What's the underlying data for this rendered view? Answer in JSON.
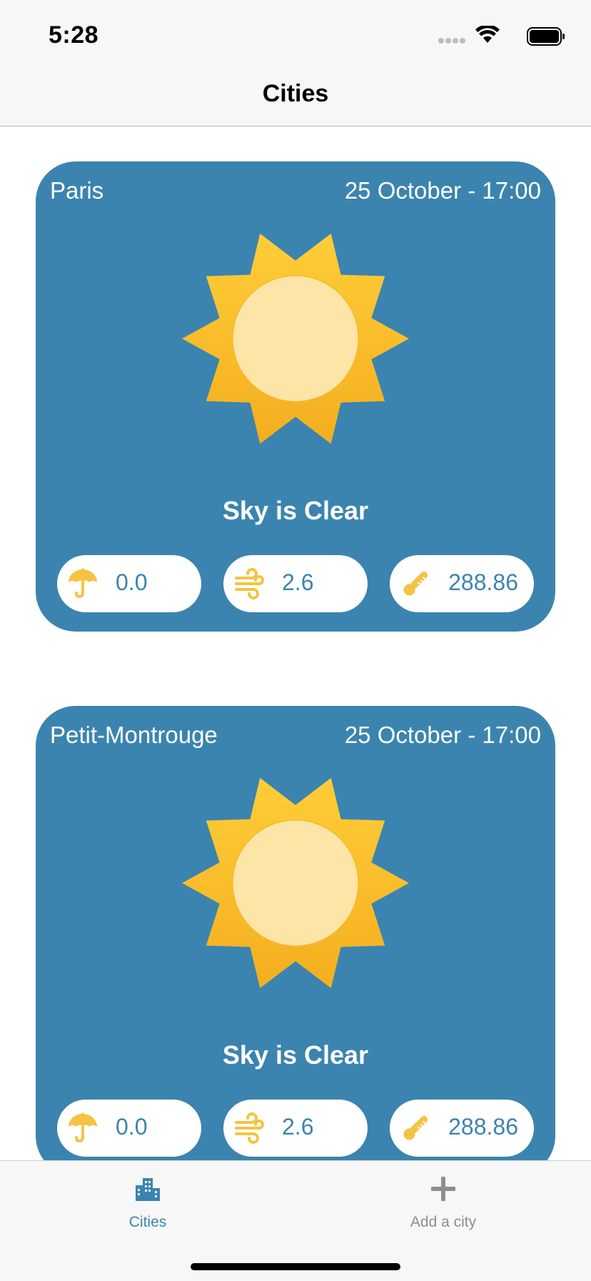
{
  "status_bar": {
    "time": "5:28"
  },
  "nav": {
    "title": "Cities"
  },
  "colors": {
    "card": "#3b84af",
    "accent": "#3b84af",
    "sun": "#f7b92b",
    "pill_icon": "#f5c342"
  },
  "cards": [
    {
      "city": "Paris",
      "date": "25 October - 17:00",
      "condition": "Sky is Clear",
      "icon": "sun-icon",
      "rain": "0.0",
      "wind": "2.6",
      "temperature": "288.86"
    },
    {
      "city": "Petit-Montrouge",
      "date": "25 October - 17:00",
      "condition": "Sky is Clear",
      "icon": "sun-icon",
      "rain": "0.0",
      "wind": "2.6",
      "temperature": "288.86"
    }
  ],
  "tabs": [
    {
      "label": "Cities",
      "icon": "city-buildings-icon",
      "selected": true
    },
    {
      "label": "Add a city",
      "icon": "plus-icon",
      "selected": false
    }
  ]
}
